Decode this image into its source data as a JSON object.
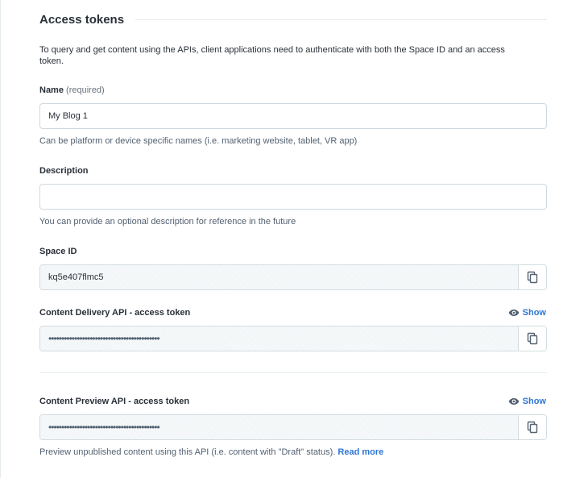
{
  "section": {
    "title": "Access tokens",
    "intro": "To query and get content using the APIs, client applications need to authenticate with both the Space ID and an access token."
  },
  "name_field": {
    "label": "Name",
    "required_hint": "(required)",
    "value": "My Blog 1",
    "help": "Can be platform or device specific names (i.e. marketing website, tablet, VR app)"
  },
  "description_field": {
    "label": "Description",
    "value": "",
    "help": "You can provide an optional description for reference in the future"
  },
  "space_id": {
    "label": "Space ID",
    "value": "kq5e407flmc5"
  },
  "delivery_token": {
    "label": "Content Delivery API - access token",
    "show_label": "Show",
    "masked_value": "•••••••••••••••••••••••••••••••••••••••••••"
  },
  "preview_token": {
    "label": "Content Preview API - access token",
    "show_label": "Show",
    "masked_value": "•••••••••••••••••••••••••••••••••••••••••••",
    "help": "Preview unpublished content using this API (i.e. content with \"Draft\" status).",
    "help_link": "Read more"
  },
  "icons": {
    "copy": "copy-icon",
    "eye": "eye-icon"
  },
  "colors": {
    "link": "#2e75d4",
    "border": "#cfd9e0",
    "text": "#2a3039",
    "muted": "#536171"
  }
}
